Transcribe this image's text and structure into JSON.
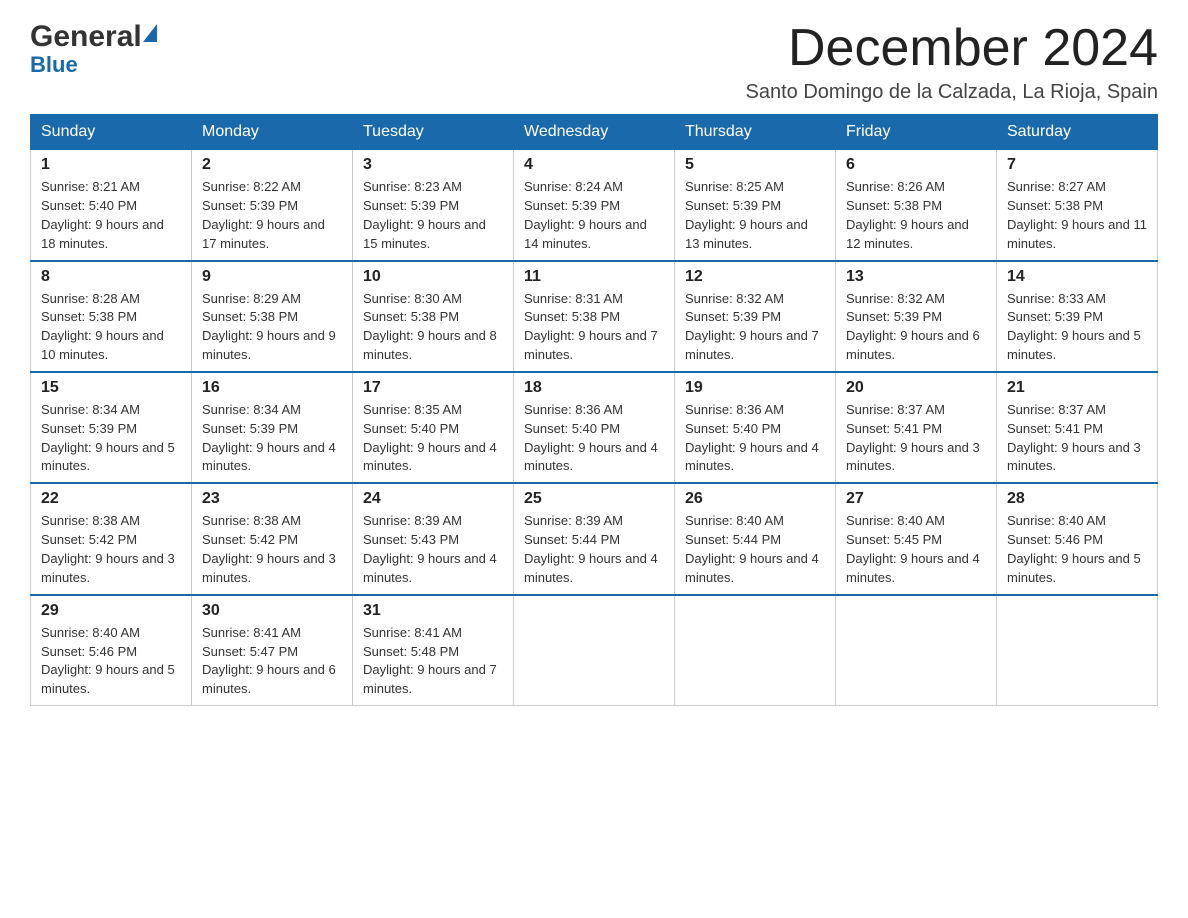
{
  "header": {
    "logo_general": "General",
    "logo_blue": "Blue",
    "month_title": "December 2024",
    "subtitle": "Santo Domingo de la Calzada, La Rioja, Spain"
  },
  "weekdays": [
    "Sunday",
    "Monday",
    "Tuesday",
    "Wednesday",
    "Thursday",
    "Friday",
    "Saturday"
  ],
  "weeks": [
    [
      {
        "day": "1",
        "sunrise": "8:21 AM",
        "sunset": "5:40 PM",
        "daylight": "9 hours and 18 minutes."
      },
      {
        "day": "2",
        "sunrise": "8:22 AM",
        "sunset": "5:39 PM",
        "daylight": "9 hours and 17 minutes."
      },
      {
        "day": "3",
        "sunrise": "8:23 AM",
        "sunset": "5:39 PM",
        "daylight": "9 hours and 15 minutes."
      },
      {
        "day": "4",
        "sunrise": "8:24 AM",
        "sunset": "5:39 PM",
        "daylight": "9 hours and 14 minutes."
      },
      {
        "day": "5",
        "sunrise": "8:25 AM",
        "sunset": "5:39 PM",
        "daylight": "9 hours and 13 minutes."
      },
      {
        "day": "6",
        "sunrise": "8:26 AM",
        "sunset": "5:38 PM",
        "daylight": "9 hours and 12 minutes."
      },
      {
        "day": "7",
        "sunrise": "8:27 AM",
        "sunset": "5:38 PM",
        "daylight": "9 hours and 11 minutes."
      }
    ],
    [
      {
        "day": "8",
        "sunrise": "8:28 AM",
        "sunset": "5:38 PM",
        "daylight": "9 hours and 10 minutes."
      },
      {
        "day": "9",
        "sunrise": "8:29 AM",
        "sunset": "5:38 PM",
        "daylight": "9 hours and 9 minutes."
      },
      {
        "day": "10",
        "sunrise": "8:30 AM",
        "sunset": "5:38 PM",
        "daylight": "9 hours and 8 minutes."
      },
      {
        "day": "11",
        "sunrise": "8:31 AM",
        "sunset": "5:38 PM",
        "daylight": "9 hours and 7 minutes."
      },
      {
        "day": "12",
        "sunrise": "8:32 AM",
        "sunset": "5:39 PM",
        "daylight": "9 hours and 7 minutes."
      },
      {
        "day": "13",
        "sunrise": "8:32 AM",
        "sunset": "5:39 PM",
        "daylight": "9 hours and 6 minutes."
      },
      {
        "day": "14",
        "sunrise": "8:33 AM",
        "sunset": "5:39 PM",
        "daylight": "9 hours and 5 minutes."
      }
    ],
    [
      {
        "day": "15",
        "sunrise": "8:34 AM",
        "sunset": "5:39 PM",
        "daylight": "9 hours and 5 minutes."
      },
      {
        "day": "16",
        "sunrise": "8:34 AM",
        "sunset": "5:39 PM",
        "daylight": "9 hours and 4 minutes."
      },
      {
        "day": "17",
        "sunrise": "8:35 AM",
        "sunset": "5:40 PM",
        "daylight": "9 hours and 4 minutes."
      },
      {
        "day": "18",
        "sunrise": "8:36 AM",
        "sunset": "5:40 PM",
        "daylight": "9 hours and 4 minutes."
      },
      {
        "day": "19",
        "sunrise": "8:36 AM",
        "sunset": "5:40 PM",
        "daylight": "9 hours and 4 minutes."
      },
      {
        "day": "20",
        "sunrise": "8:37 AM",
        "sunset": "5:41 PM",
        "daylight": "9 hours and 3 minutes."
      },
      {
        "day": "21",
        "sunrise": "8:37 AM",
        "sunset": "5:41 PM",
        "daylight": "9 hours and 3 minutes."
      }
    ],
    [
      {
        "day": "22",
        "sunrise": "8:38 AM",
        "sunset": "5:42 PM",
        "daylight": "9 hours and 3 minutes."
      },
      {
        "day": "23",
        "sunrise": "8:38 AM",
        "sunset": "5:42 PM",
        "daylight": "9 hours and 3 minutes."
      },
      {
        "day": "24",
        "sunrise": "8:39 AM",
        "sunset": "5:43 PM",
        "daylight": "9 hours and 4 minutes."
      },
      {
        "day": "25",
        "sunrise": "8:39 AM",
        "sunset": "5:44 PM",
        "daylight": "9 hours and 4 minutes."
      },
      {
        "day": "26",
        "sunrise": "8:40 AM",
        "sunset": "5:44 PM",
        "daylight": "9 hours and 4 minutes."
      },
      {
        "day": "27",
        "sunrise": "8:40 AM",
        "sunset": "5:45 PM",
        "daylight": "9 hours and 4 minutes."
      },
      {
        "day": "28",
        "sunrise": "8:40 AM",
        "sunset": "5:46 PM",
        "daylight": "9 hours and 5 minutes."
      }
    ],
    [
      {
        "day": "29",
        "sunrise": "8:40 AM",
        "sunset": "5:46 PM",
        "daylight": "9 hours and 5 minutes."
      },
      {
        "day": "30",
        "sunrise": "8:41 AM",
        "sunset": "5:47 PM",
        "daylight": "9 hours and 6 minutes."
      },
      {
        "day": "31",
        "sunrise": "8:41 AM",
        "sunset": "5:48 PM",
        "daylight": "9 hours and 7 minutes."
      },
      null,
      null,
      null,
      null
    ]
  ]
}
